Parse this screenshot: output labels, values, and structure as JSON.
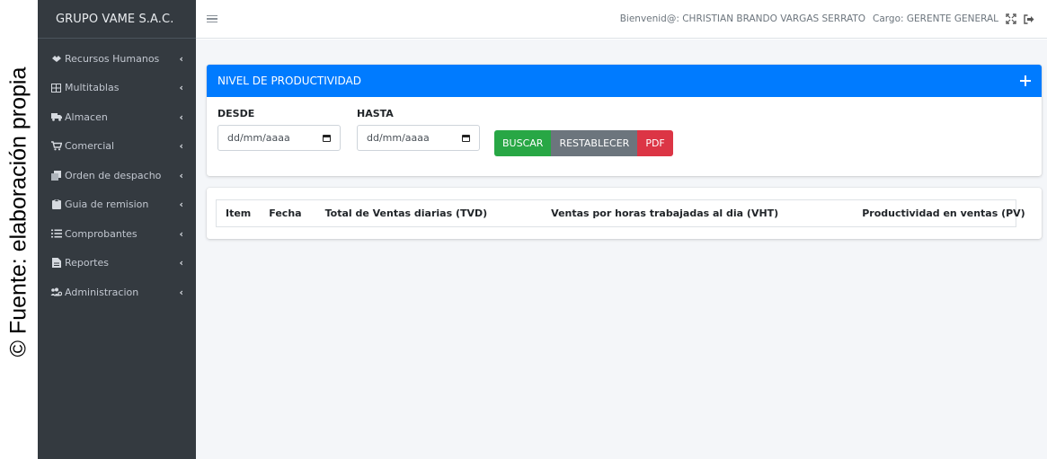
{
  "caption": "© Fuente: elaboración propia",
  "sidebar": {
    "brand": "GRUPO VAME S.A.C.",
    "items": [
      {
        "label": "Recursos Humanos",
        "icon": "handshake-icon"
      },
      {
        "label": "Multitablas",
        "icon": "table-icon"
      },
      {
        "label": "Almacen",
        "icon": "truck-icon"
      },
      {
        "label": "Comercial",
        "icon": "cart-icon"
      },
      {
        "label": "Orden de despacho",
        "icon": "copy-icon"
      },
      {
        "label": "Guia de remision",
        "icon": "clipboard-icon"
      },
      {
        "label": "Comprobantes",
        "icon": "list-icon"
      },
      {
        "label": "Reportes",
        "icon": "file-icon"
      },
      {
        "label": "Administracion",
        "icon": "users-cog-icon"
      }
    ]
  },
  "topbar": {
    "welcome": "Bienvenid@: CHRISTIAN BRANDO VARGAS SERRATO",
    "role": "Cargo: GERENTE GENERAL",
    "icons": [
      "expand-icon",
      "sign-out-icon"
    ]
  },
  "panel": {
    "title": "NIVEL DE PRODUCTIVIDAD",
    "desde_label": "DESDE",
    "hasta_label": "HASTA",
    "date_placeholder": "dd/mm/aaaa",
    "buttons": {
      "buscar": "BUSCAR",
      "restablecer": "RESTABLECER",
      "pdf": "PDF"
    }
  },
  "table": {
    "columns": [
      "Item",
      "Fecha",
      "Total de Ventas diarias (TVD)",
      "Ventas por horas trabajadas al dia (VHT)",
      "Productividad en ventas (PV)"
    ]
  },
  "colors": {
    "sidebar_bg": "#343a40",
    "header_blue": "#007bff",
    "buscar_green": "#28a745",
    "restablecer_gray": "#6c757d",
    "pdf_red": "#dc3545"
  }
}
